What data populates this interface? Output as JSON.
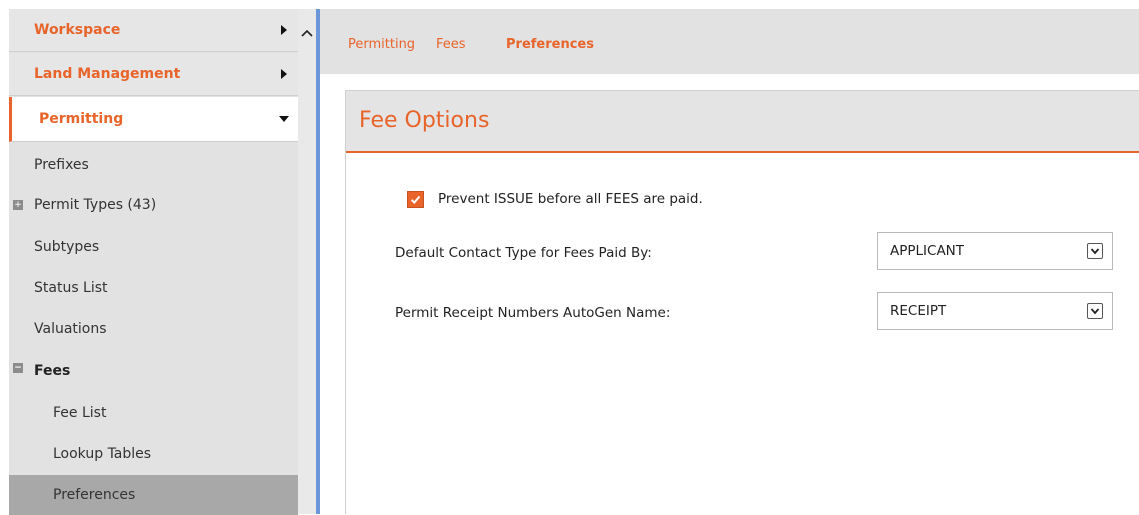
{
  "sidebar": {
    "headers": [
      {
        "label": "Workspace",
        "state": "collapsed"
      },
      {
        "label": "Land Management",
        "state": "collapsed"
      },
      {
        "label": "Permitting",
        "state": "expanded"
      }
    ],
    "items": [
      {
        "label": "Prefixes"
      },
      {
        "label": "Permit Types (43)",
        "expander": "plus"
      },
      {
        "label": "Subtypes"
      },
      {
        "label": "Status List"
      },
      {
        "label": "Valuations"
      },
      {
        "label": "Fees",
        "expander": "minus"
      },
      {
        "label": "Fee List"
      },
      {
        "label": "Lookup Tables"
      },
      {
        "label": "Preferences",
        "selected": true
      }
    ]
  },
  "breadcrumb": [
    "Permitting",
    "Fees",
    "Preferences"
  ],
  "panel": {
    "title": "Fee Options",
    "checkbox": {
      "label": "Prevent ISSUE before all FEES are paid.",
      "checked": true
    },
    "fields": [
      {
        "label": "Default Contact Type for Fees Paid By:",
        "value": "APPLICANT"
      },
      {
        "label": "Permit Receipt Numbers AutoGen Name:",
        "value": "RECEIPT"
      }
    ]
  },
  "colors": {
    "accent": "#e8642a",
    "divider": "#6b97d8",
    "selected": "#a8a8a8"
  },
  "icons": [
    "caret-right-icon",
    "caret-down-icon",
    "scroll-up-icon",
    "expand-plus-icon",
    "collapse-minus-icon",
    "checkmark-icon",
    "dropdown-arrow-icon"
  ]
}
